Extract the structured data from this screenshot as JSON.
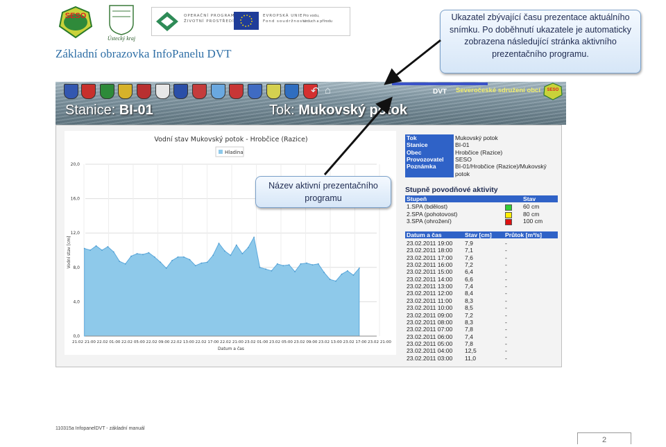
{
  "document": {
    "title": "Základní obrazovka InfoPanelu DVT",
    "footer": "110315a InfopanelDVT - základní manuál",
    "page_number": "2"
  },
  "logos": {
    "seso": "SESO",
    "kraj": "Ústecký kraj",
    "op_line1": "OPERAČNÍ PROGRAM",
    "op_line2": "ŽIVOTNÍ PROSTŘEDÍ",
    "eu_line1": "EVROPSKÁ UNIE",
    "eu_line2": "Fond soudržnosti",
    "eu_sub1": "Pro vodu,",
    "eu_sub2": "vzduch a přírodu"
  },
  "callouts": {
    "time_indicator": "Ukazatel zbývající času prezentace aktuálního snímku. Po doběhnutí ukazatele je automaticky zobrazena následující stránka aktivního prezentačního programu.",
    "program_name": "Název aktivní prezentačního programu"
  },
  "screen": {
    "tab": "DVT",
    "org_title": "Severočeské sdružení obcí",
    "station_label": "Stanice:",
    "station_value": "BI-01",
    "river_label": "Tok:",
    "river_value": "Mukovský potok"
  },
  "info": {
    "rows": [
      {
        "key": "Tok",
        "value": "Mukovský potok"
      },
      {
        "key": "Stanice",
        "value": "BI-01"
      },
      {
        "key": "Obec",
        "value": "Hrobčice (Razice)"
      },
      {
        "key": "Provozovatel",
        "value": "SESO"
      },
      {
        "key": "Poznámka",
        "value": "BI-01/Hrobčice (Razice)/Mukovský"
      },
      {
        "key": "",
        "value": "potok"
      }
    ]
  },
  "levels": {
    "title": "Stupně povodňové aktivity",
    "col_stage": "Stupeň",
    "col_state": "Stav",
    "rows": [
      {
        "stage": "1.SPA (bdělost)",
        "value": "60 cm",
        "color": "#33cc33"
      },
      {
        "stage": "2.SPA (pohotovost)",
        "value": "80 cm",
        "color": "#ffee00"
      },
      {
        "stage": "3.SPA (ohrožení)",
        "value": "100 cm",
        "color": "#dd1111"
      }
    ]
  },
  "readings": {
    "col_time": "Datum a čas",
    "col_state": "Stav [cm]",
    "col_flow": "Průtok [m³/s]",
    "rows": [
      {
        "t": "23.02.2011 19:00",
        "v": "7,9",
        "q": "-"
      },
      {
        "t": "23.02.2011 18:00",
        "v": "7,1",
        "q": "-"
      },
      {
        "t": "23.02.2011 17:00",
        "v": "7,6",
        "q": "-"
      },
      {
        "t": "23.02.2011 16:00",
        "v": "7,2",
        "q": "-"
      },
      {
        "t": "23.02.2011 15:00",
        "v": "6,4",
        "q": "-"
      },
      {
        "t": "23.02.2011 14:00",
        "v": "6,6",
        "q": "-"
      },
      {
        "t": "23.02.2011 13:00",
        "v": "7,4",
        "q": "-"
      },
      {
        "t": "23.02.2011 12:00",
        "v": "8,4",
        "q": "-"
      },
      {
        "t": "23.02.2011 11:00",
        "v": "8,3",
        "q": "-"
      },
      {
        "t": "23.02.2011 10:00",
        "v": "8,5",
        "q": "-"
      },
      {
        "t": "23.02.2011 09:00",
        "v": "7,2",
        "q": "-"
      },
      {
        "t": "23.02.2011 08:00",
        "v": "8,3",
        "q": "-"
      },
      {
        "t": "23.02.2011 07:00",
        "v": "7,8",
        "q": "-"
      },
      {
        "t": "23.02.2011 06:00",
        "v": "7,4",
        "q": "-"
      },
      {
        "t": "23.02.2011 05:00",
        "v": "7,8",
        "q": "-"
      },
      {
        "t": "23.02.2011 04:00",
        "v": "12,5",
        "q": "-"
      },
      {
        "t": "23.02.2011 03:00",
        "v": "11,0",
        "q": "-"
      }
    ]
  },
  "chart_data": {
    "type": "area",
    "title": "Vodní stav Mukovský potok - Hrobčice (Razice)",
    "xlabel": "Datum a čas",
    "ylabel": "Vodní stav [cm]",
    "ylim": [
      0,
      20
    ],
    "yticks": [
      "0,0",
      "4,0",
      "8,0",
      "12,0",
      "16,0",
      "20,0"
    ],
    "xticks": [
      "21.02 21:00",
      "22.02 01:00",
      "22.02 05:00",
      "22.02 09:00",
      "22.02 13:00",
      "22.02 17:00",
      "22.02 21:00",
      "23.02 01:00",
      "23.02 05:00",
      "23.02 09:00",
      "23.02 13:00",
      "23.02 17:00",
      "23.02 21:00"
    ],
    "grid": true,
    "legend": "top",
    "color": "#8ec9ea",
    "series": [
      {
        "name": "Hladina",
        "values": [
          10.2,
          10.0,
          10.5,
          10.0,
          10.4,
          9.8,
          8.7,
          8.4,
          9.3,
          9.6,
          9.5,
          9.7,
          9.2,
          8.6,
          7.9,
          8.8,
          9.2,
          9.2,
          8.9,
          8.2,
          8.5,
          8.6,
          9.4,
          10.8,
          9.9,
          9.4,
          10.6,
          9.6,
          10.3,
          11.5,
          8.0,
          7.8,
          7.6,
          8.4,
          8.2,
          8.3,
          7.5,
          8.4,
          8.5,
          8.3,
          8.4,
          7.4,
          6.6,
          6.4,
          7.2,
          7.6,
          7.1,
          7.9
        ]
      }
    ]
  }
}
